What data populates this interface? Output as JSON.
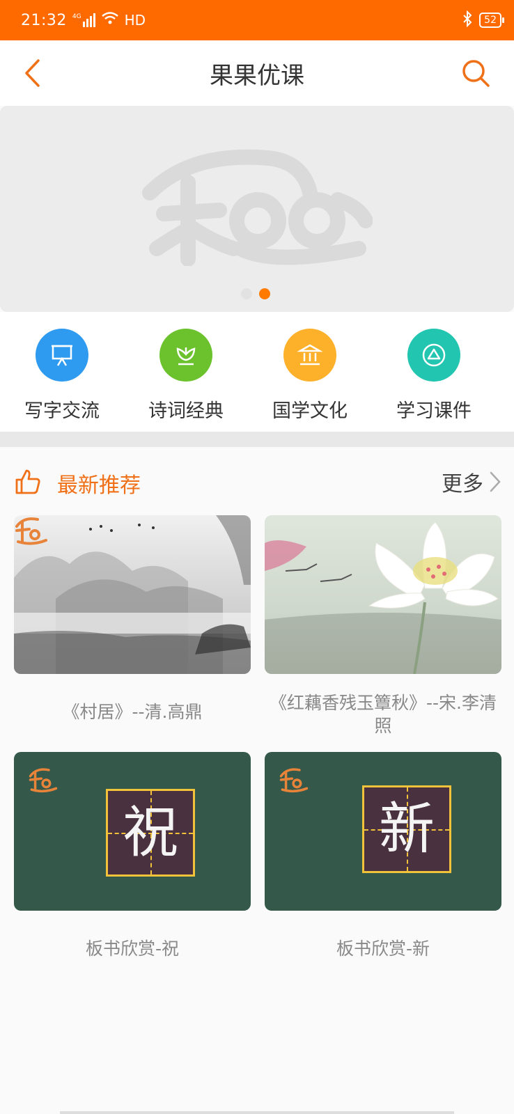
{
  "status_bar": {
    "time": "21:32",
    "network": "4G",
    "hd": "HD",
    "battery": "52"
  },
  "header": {
    "title": "果果优课"
  },
  "banner": {
    "active_dot_index": 1,
    "dot_count": 2
  },
  "categories": [
    {
      "label": "写字交流",
      "icon": "presentation-board-icon",
      "color": "#2f9bf0"
    },
    {
      "label": "诗词经典",
      "icon": "lotus-icon",
      "color": "#6bc22c"
    },
    {
      "label": "国学文化",
      "icon": "temple-icon",
      "color": "#fdb02a"
    },
    {
      "label": "学习课件",
      "icon": "triangle-play-icon",
      "color": "#22c6b0"
    }
  ],
  "section": {
    "title": "最新推荐",
    "more_label": "更多"
  },
  "cards": [
    {
      "caption": "《村居》--清.高鼎"
    },
    {
      "caption": "《红藕香残玉簟秋》--宋.李清照"
    },
    {
      "caption": "板书欣赏-祝",
      "char": "祝"
    },
    {
      "caption": "板书欣赏-新",
      "char": "新"
    }
  ],
  "colors": {
    "accent": "#ff6a00",
    "section_title": "#f07018"
  }
}
